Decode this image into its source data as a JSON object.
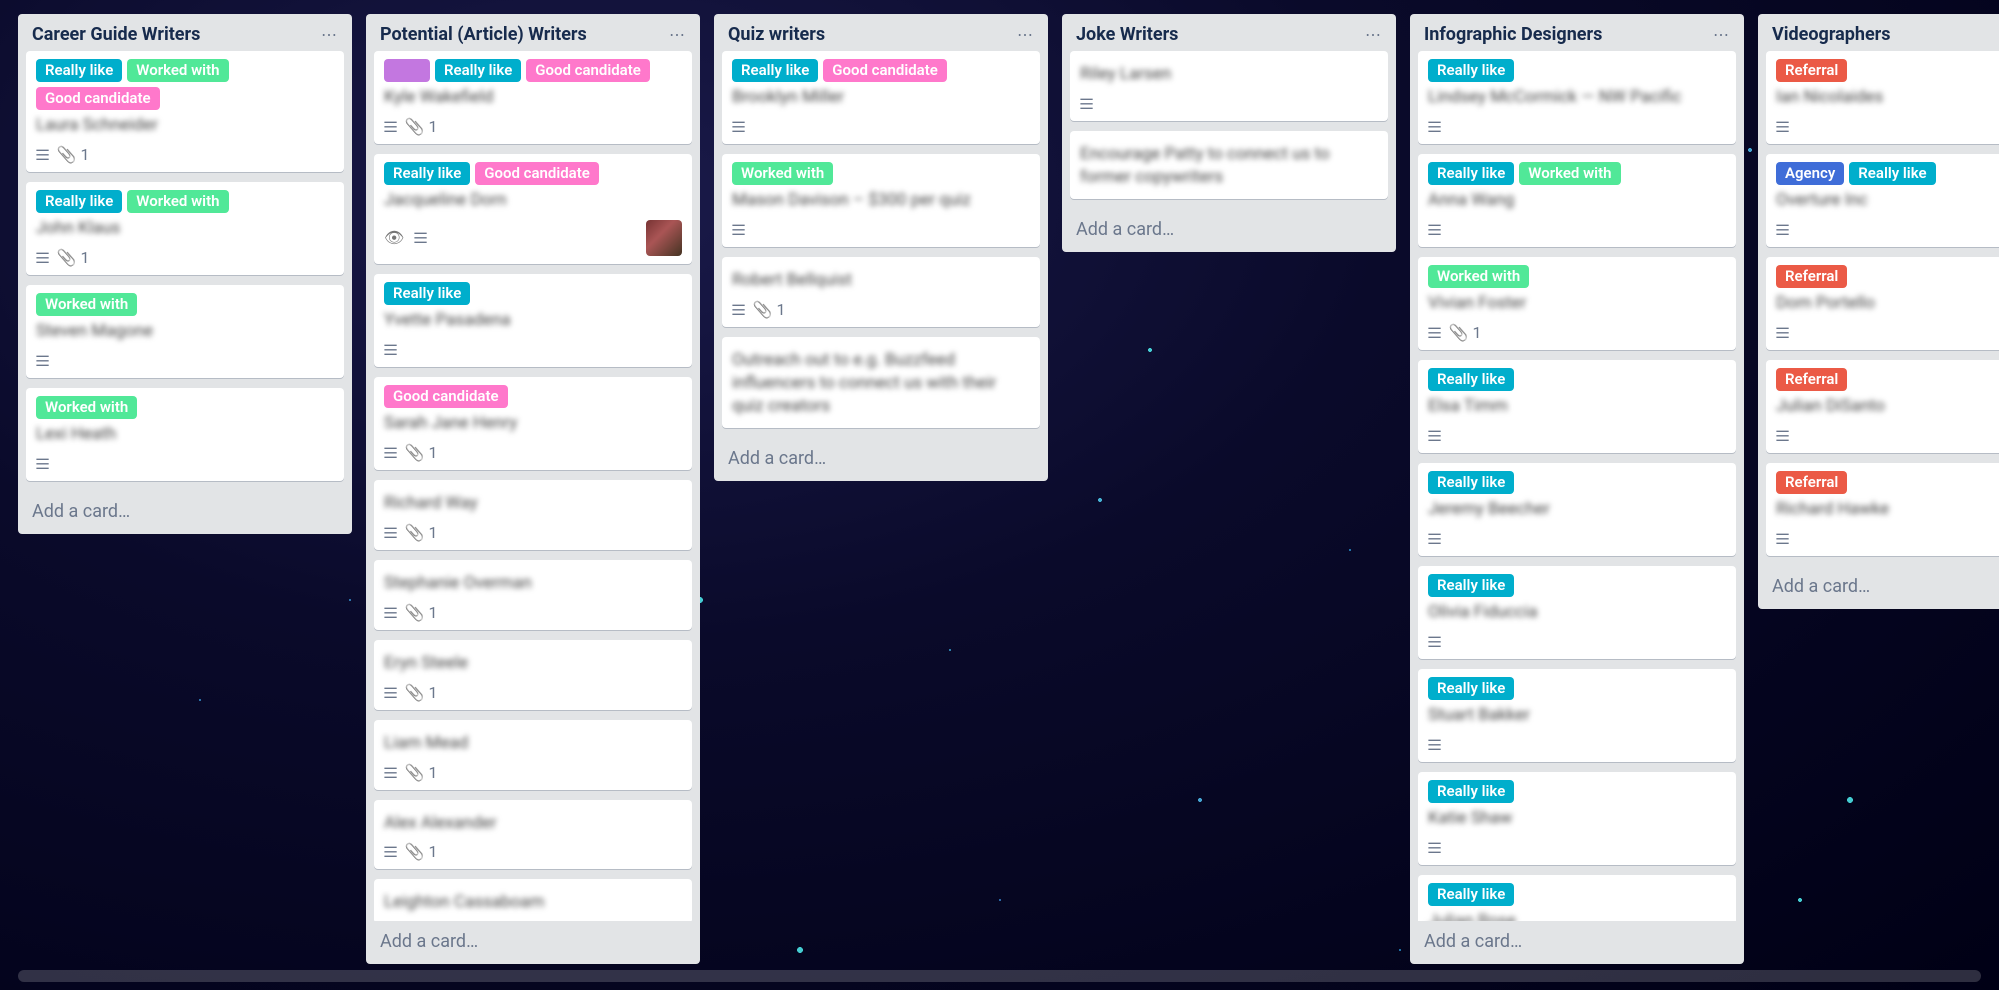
{
  "addCardLabel": "Add a card…",
  "labelColors": {
    "really_like": "l-blue",
    "worked_with": "l-green",
    "good_candidate": "l-pink",
    "purple_blank": "l-purple",
    "referral": "l-red",
    "agency": "l-navy"
  },
  "labelText": {
    "really_like": "Really like",
    "worked_with": "Worked with",
    "good_candidate": "Good candidate",
    "referral": "Referral",
    "agency": "Agency"
  },
  "lists": [
    {
      "title": "Career Guide Writers",
      "cards": [
        {
          "labels": [
            "really_like",
            "worked_with",
            "good_candidate"
          ],
          "title": "Laura Schneider",
          "desc": true,
          "attach": 1
        },
        {
          "labels": [
            "really_like",
            "worked_with"
          ],
          "title": "John Klaus",
          "desc": true,
          "attach": 1
        },
        {
          "labels": [
            "worked_with"
          ],
          "title": "Steven Magone",
          "desc": true
        },
        {
          "labels": [
            "worked_with"
          ],
          "title": "Lexi Heath",
          "desc": true
        }
      ]
    },
    {
      "title": "Potential (Article) Writers",
      "cards": [
        {
          "labels": [
            "purple_blank",
            "really_like",
            "good_candidate"
          ],
          "title": "Kyle Wakefield",
          "desc": true,
          "attach": 1
        },
        {
          "labels": [
            "really_like",
            "good_candidate"
          ],
          "title": "Jacqueline Dorn",
          "eye": true,
          "desc": true,
          "avatar": true
        },
        {
          "labels": [
            "really_like"
          ],
          "title": "Yvette Pasadena",
          "desc": true
        },
        {
          "labels": [
            "good_candidate"
          ],
          "title": "Sarah Jane Henry",
          "desc": true,
          "attach": 1
        },
        {
          "labels": [],
          "title": "Richard Way",
          "desc": true,
          "attach": 1
        },
        {
          "labels": [],
          "title": "Stephanie Overman",
          "desc": true,
          "attach": 1
        },
        {
          "labels": [],
          "title": "Eryn Steele",
          "desc": true,
          "attach": 1
        },
        {
          "labels": [],
          "title": "Liam Mead",
          "desc": true,
          "attach": 1
        },
        {
          "labels": [],
          "title": "Alex Alexander",
          "desc": true,
          "attach": 1
        },
        {
          "labels": [],
          "title": "Leighton Cassaboam",
          "desc": false
        }
      ]
    },
    {
      "title": "Quiz writers",
      "cards": [
        {
          "labels": [
            "really_like",
            "good_candidate"
          ],
          "title": "Brooklyn Miller",
          "desc": true
        },
        {
          "labels": [
            "worked_with"
          ],
          "title": "Mason Davison – $300 per quiz",
          "desc": true
        },
        {
          "labels": [],
          "title": "Robert Bellquist",
          "desc": true,
          "attach": 1
        },
        {
          "labels": [],
          "title": "Outreach out to e.g. Buzzfeed influencers to connect us with their quiz creators",
          "desc": false,
          "noblur": true
        }
      ]
    },
    {
      "title": "Joke Writers",
      "cards": [
        {
          "labels": [],
          "title": "Riley Larsen",
          "desc": true
        },
        {
          "labels": [],
          "title": "Encourage Patty to connect us to former copywriters",
          "desc": false,
          "noblur": true
        }
      ]
    },
    {
      "title": "Infographic Designers",
      "cards": [
        {
          "labels": [
            "really_like"
          ],
          "title": "Lindsey McCormick — NW Pacific",
          "desc": true
        },
        {
          "labels": [
            "really_like",
            "worked_with"
          ],
          "title": "Anna Wang",
          "desc": true
        },
        {
          "labels": [
            "worked_with"
          ],
          "title": "Vivian Foster",
          "desc": true,
          "attach": 1
        },
        {
          "labels": [
            "really_like"
          ],
          "title": "Elsa Timm",
          "desc": true
        },
        {
          "labels": [
            "really_like"
          ],
          "title": "Jeremy Beecher",
          "desc": true
        },
        {
          "labels": [
            "really_like"
          ],
          "title": "Olivia Fiduccia",
          "desc": true
        },
        {
          "labels": [
            "really_like"
          ],
          "title": "Stuart Bakker",
          "desc": true
        },
        {
          "labels": [
            "really_like"
          ],
          "title": "Katie Shaw",
          "desc": true
        },
        {
          "labels": [
            "really_like"
          ],
          "title": "Julian Rose",
          "desc": false
        }
      ]
    },
    {
      "title": "Videographers",
      "cards": [
        {
          "labels": [
            "referral"
          ],
          "title": "Ian Nicolaides",
          "desc": true
        },
        {
          "labels": [
            "agency",
            "really_like"
          ],
          "title": "Overture Inc",
          "desc": true
        },
        {
          "labels": [
            "referral"
          ],
          "title": "Dom Portello",
          "desc": true
        },
        {
          "labels": [
            "referral"
          ],
          "title": "Julian DiSanto",
          "desc": true
        },
        {
          "labels": [
            "referral"
          ],
          "title": "Richard Hawke",
          "desc": true
        }
      ]
    }
  ]
}
